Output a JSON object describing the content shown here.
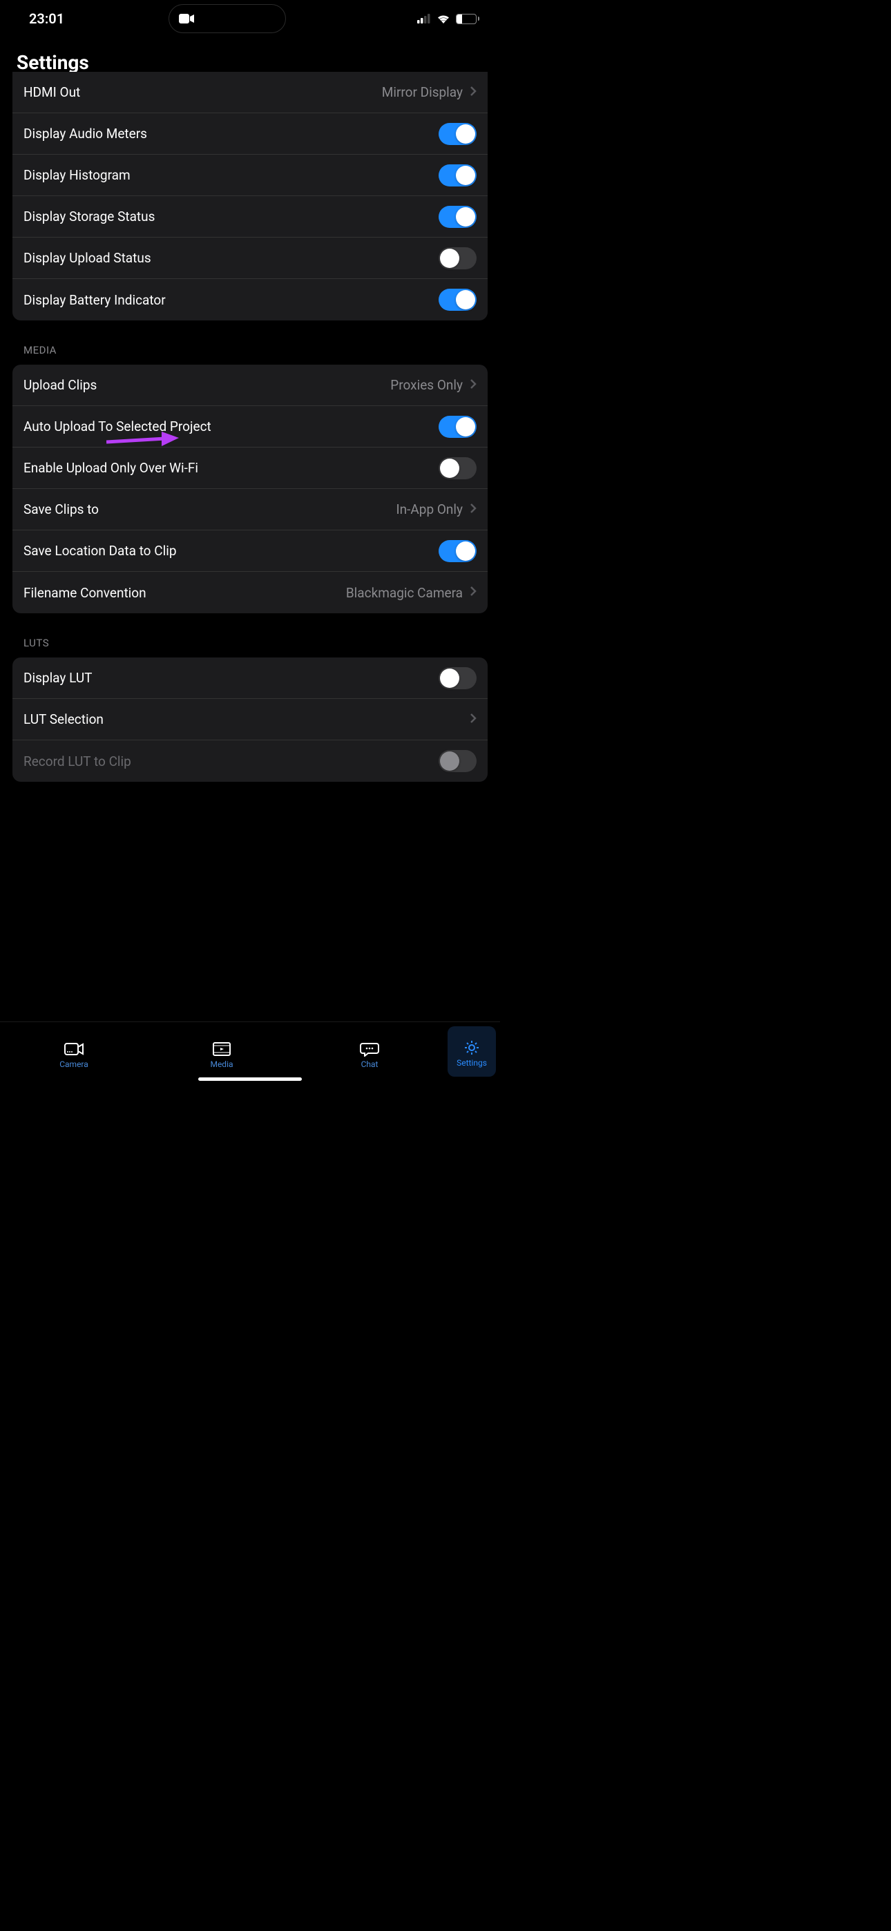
{
  "status": {
    "time": "23:01",
    "battery": "26"
  },
  "title": "Settings",
  "groups": {
    "display": {
      "hdmi_out": {
        "label": "HDMI Out",
        "value": "Mirror Display"
      },
      "audio_meters": {
        "label": "Display Audio Meters",
        "on": true
      },
      "histogram": {
        "label": "Display Histogram",
        "on": true
      },
      "storage": {
        "label": "Display Storage Status",
        "on": true
      },
      "upload": {
        "label": "Display Upload Status",
        "on": false
      },
      "battery_ind": {
        "label": "Display Battery Indicator",
        "on": true
      }
    },
    "media": {
      "header": "MEDIA",
      "upload_clips": {
        "label": "Upload Clips",
        "value": "Proxies Only"
      },
      "auto_upload": {
        "label": "Auto Upload To Selected Project",
        "on": true
      },
      "wifi_only": {
        "label": "Enable Upload Only Over Wi-Fi",
        "on": false
      },
      "save_clips": {
        "label": "Save Clips to",
        "value": "In-App Only"
      },
      "save_location": {
        "label": "Save Location Data to Clip",
        "on": true
      },
      "filename": {
        "label": "Filename Convention",
        "value": "Blackmagic Camera"
      }
    },
    "luts": {
      "header": "LUTS",
      "display_lut": {
        "label": "Display LUT",
        "on": false
      },
      "lut_selection": {
        "label": "LUT Selection"
      },
      "record_lut": {
        "label": "Record LUT to Clip",
        "on": false,
        "disabled": true
      }
    }
  },
  "tabs": {
    "camera": "Camera",
    "media": "Media",
    "chat": "Chat",
    "settings": "Settings"
  }
}
